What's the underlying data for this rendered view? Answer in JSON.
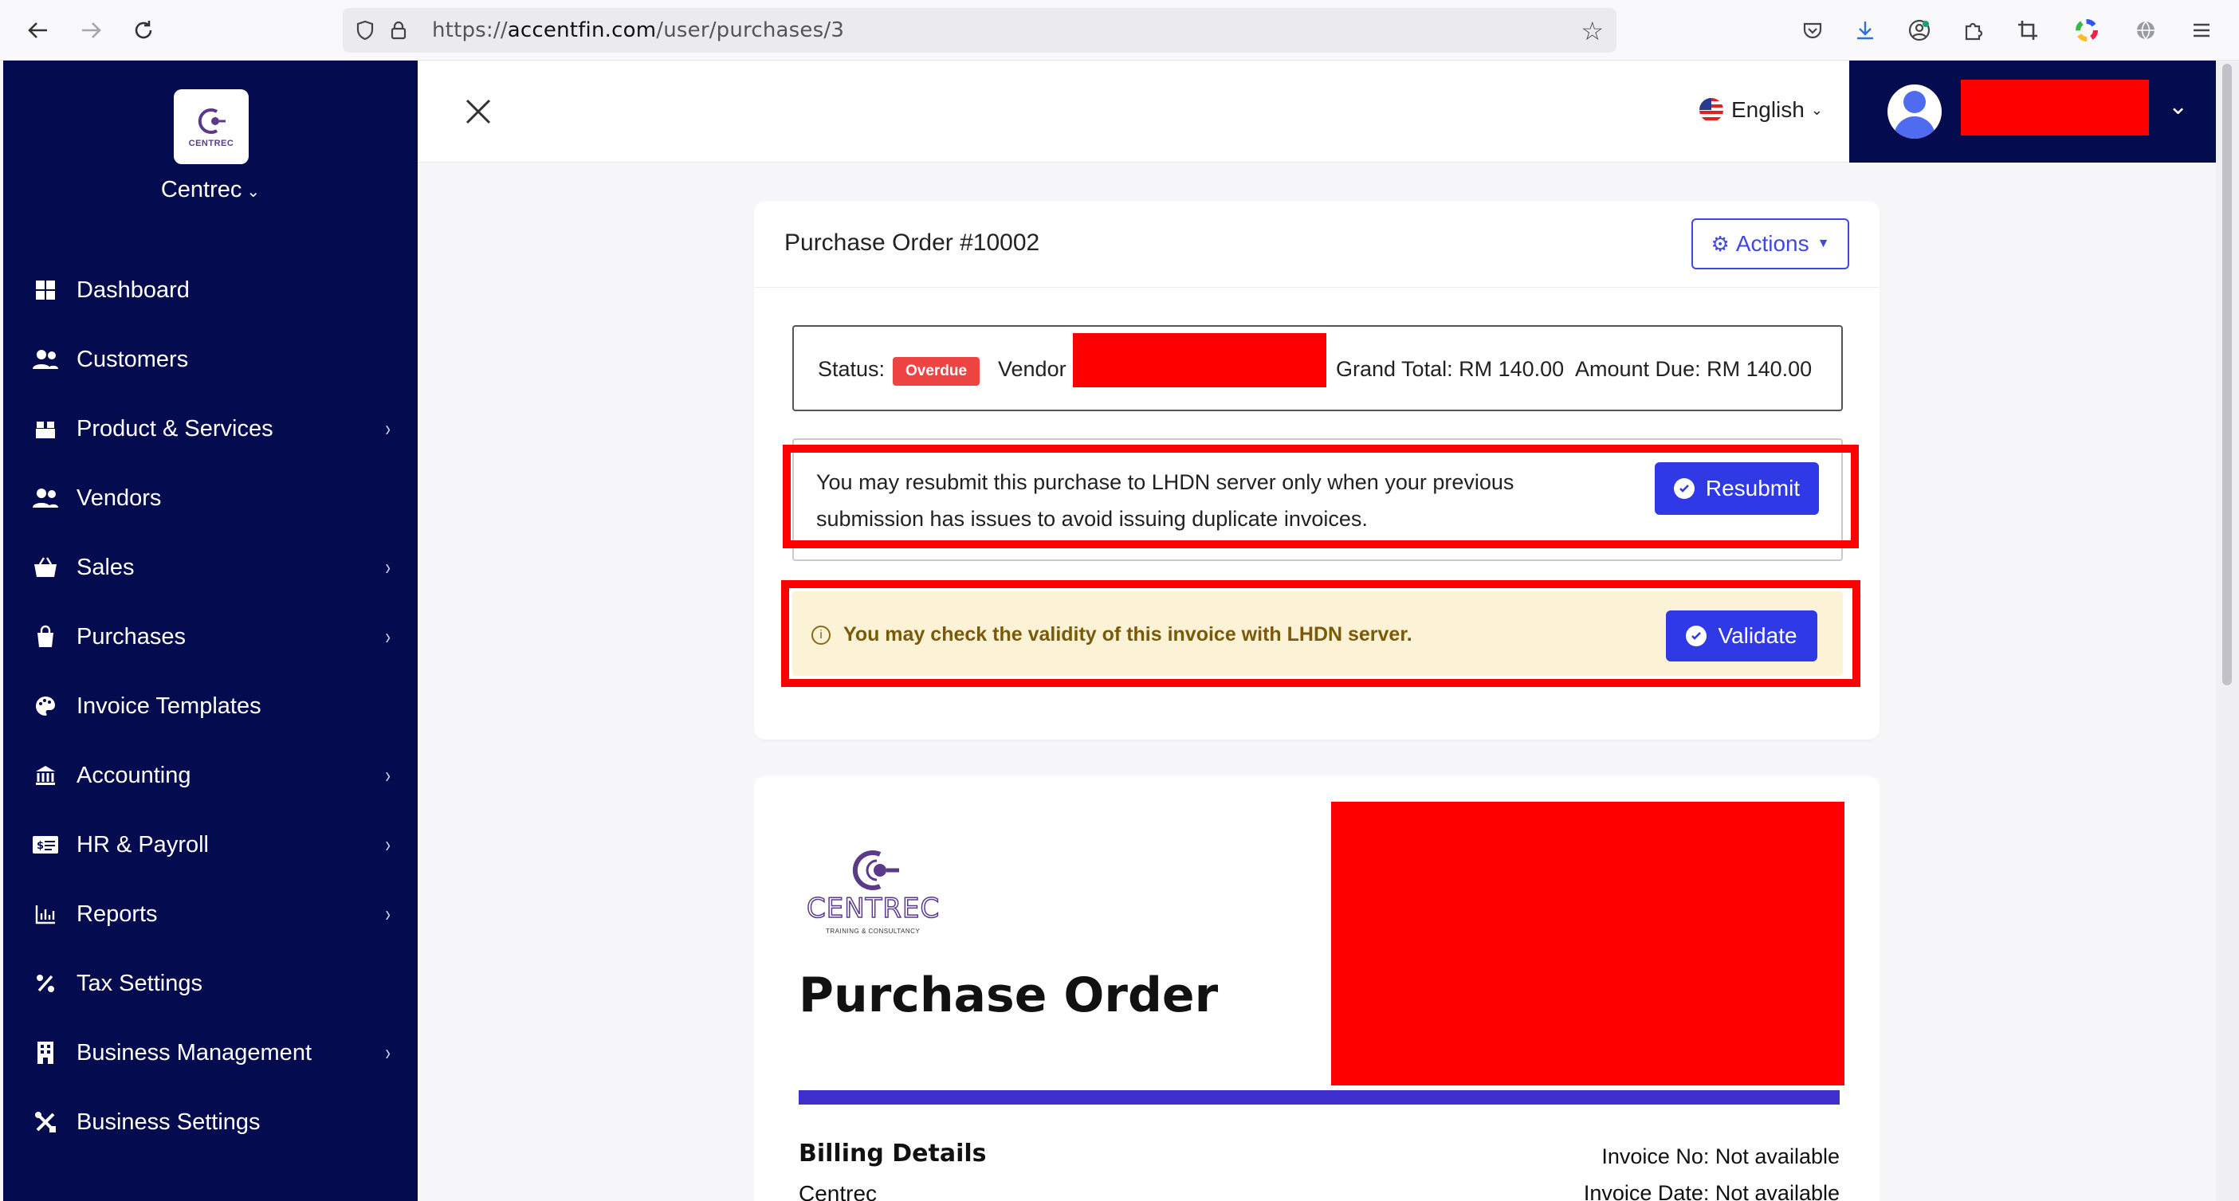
{
  "browser": {
    "url_prefix": "https://",
    "url_domain": "accentfin.com",
    "url_path": "/user/purchases/3"
  },
  "sidebar": {
    "logo_mini": "CENTREC",
    "brand": "Centrec",
    "items": [
      {
        "label": "Dashboard",
        "icon": "dashboard-icon",
        "submenu": false
      },
      {
        "label": "Customers",
        "icon": "users-icon",
        "submenu": false
      },
      {
        "label": "Product & Services",
        "icon": "box-icon",
        "submenu": true
      },
      {
        "label": "Vendors",
        "icon": "users-icon",
        "submenu": false
      },
      {
        "label": "Sales",
        "icon": "basket-icon",
        "submenu": true
      },
      {
        "label": "Purchases",
        "icon": "bag-icon",
        "submenu": true
      },
      {
        "label": "Invoice Templates",
        "icon": "palette-icon",
        "submenu": false
      },
      {
        "label": "Accounting",
        "icon": "bank-icon",
        "submenu": true
      },
      {
        "label": "HR & Payroll",
        "icon": "id-card-icon",
        "submenu": true
      },
      {
        "label": "Reports",
        "icon": "chart-icon",
        "submenu": true
      },
      {
        "label": "Tax Settings",
        "icon": "percent-icon",
        "submenu": false
      },
      {
        "label": "Business Management",
        "icon": "building-icon",
        "submenu": true
      },
      {
        "label": "Business Settings",
        "icon": "tools-icon",
        "submenu": false
      }
    ]
  },
  "header": {
    "language": "English"
  },
  "order": {
    "title": "Purchase Order #10002",
    "actions_label": "Actions",
    "status_label": "Status:",
    "status_value": "Overdue",
    "vendor_label": "Vendor",
    "grand_total": "Grand Total: RM 140.00",
    "amount_due": "Amount Due: RM 140.00",
    "resubmit_text": "You may resubmit this purchase to LHDN server only when your previous submission has issues to avoid issuing duplicate invoices.",
    "resubmit_label": "Resubmit",
    "validate_text": "You may check the validity of this invoice with LHDN server.",
    "validate_label": "Validate"
  },
  "document": {
    "logo_text": "CENTREC",
    "logo_sub": "TRAINING & CONSULTANCY",
    "title": "Purchase Order",
    "billing_title": "Billing Details",
    "billing_name": "Centrec",
    "invoice_no": "Invoice No: Not available",
    "invoice_date": "Invoice Date: Not available"
  },
  "colors": {
    "sidebar_bg": "#050b4f",
    "accent_blue": "#2f39e6",
    "overdue_red": "#ef4444",
    "highlight_red": "#ff0000",
    "doc_bar": "#3f2fcf",
    "warning_bg": "#fcf3d6"
  }
}
